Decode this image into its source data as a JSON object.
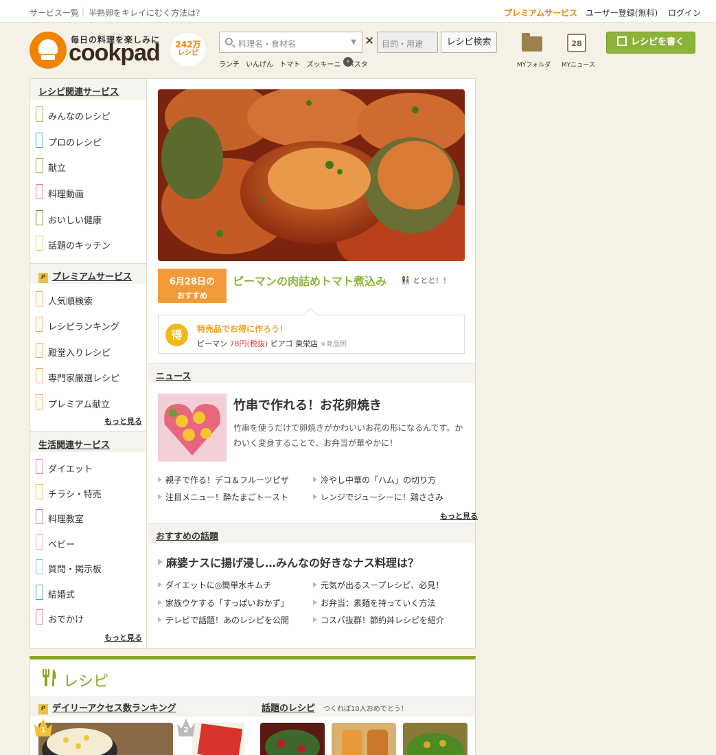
{
  "topbar": {
    "left_links": [
      "サービス一覧",
      "半熟卵をキレイにむく方法は？"
    ],
    "premium": "プレミアムサービス",
    "register": "ユーザー登録(無料)",
    "login": "ログイン"
  },
  "header": {
    "tagline": "毎日の料理を楽しみに",
    "wordmark": "cookpad",
    "recipe_count": "242万",
    "recipe_count_label": "レシピ",
    "search_placeholder": "料理名・食材名",
    "purpose_placeholder": "目的・用途",
    "search_button": "レシピ検索",
    "popular_keywords": [
      "ランチ",
      "いんげん",
      "トマト",
      "ズッキーニ",
      "パスタ"
    ],
    "my_folder": "MYフォルダ",
    "my_news": "MYニュース",
    "calendar_day": "28",
    "write_button": "レシピを書く"
  },
  "sidebar": {
    "recipe_services": {
      "title": "レシピ関連サービス",
      "items": [
        "みんなのレシピ",
        "プロのレシピ",
        "献立",
        "料理動画",
        "おいしい健康",
        "話題のキッチン"
      ]
    },
    "premium_services": {
      "badge": "P",
      "title": "プレミアムサービス",
      "items": [
        "人気順検索",
        "レシピランキング",
        "殿堂入りレシピ",
        "専門家厳選レシピ",
        "プレミアム献立"
      ],
      "more": "もっと見る"
    },
    "life_services": {
      "title": "生活関連サービス",
      "items": [
        "ダイエット",
        "チラシ・特売",
        "料理教室",
        "ベビー",
        "質問・掲示板",
        "結婚式",
        "おでかけ"
      ],
      "more": "もっと見る"
    }
  },
  "featured": {
    "date": "6月28日の",
    "date_sub": "おすすめ",
    "title": "ピーマンの肉詰めトマト煮込み",
    "author": "ととと！！",
    "deal_icon": "得",
    "deal_title": "特売品でお得に作ろう！",
    "deal_item": "ピーマン",
    "deal_price": "78円(税抜)",
    "deal_store": "ピアゴ 東栄店",
    "deal_note": "※商品例"
  },
  "news": {
    "section_title": "ニュース",
    "headline": "竹串で作れる！お花卵焼き",
    "description": "竹串を使うだけで卵焼きがかわいいお花の形になるんです。かわいく変身することで、お弁当が華やかに！",
    "links": [
      "親子で作る！デコ＆フルーツピザ",
      "冷やし中華の「ハム」の切り方",
      "注目メニュー！酔たまごトースト",
      "レンジでジューシーに！鶏ささみ"
    ],
    "more": "もっと見る"
  },
  "topics": {
    "section_title": "おすすめの話題",
    "headline": "麻婆ナスに揚げ浸し…みんなの好きなナス料理は？",
    "links": [
      "ダイエットに◎簡単水キムチ",
      "元気が出るスープレシピ、必見！",
      "家族ウケする「すっぱいおかず」",
      "お弁当：素麺を持っていく方法",
      "テレビで話題！あのレシピを公開",
      "コスパ抜群！節約丼レシピを紹介"
    ]
  },
  "recipes": {
    "title": "レシピ",
    "ranking_badge": "P",
    "ranking_title": "デイリーアクセス数ランキング",
    "rank1": "1",
    "rank2": "2",
    "trending_title": "話題のレシピ",
    "trending_sub": "つくれぽ10人おめでとう！"
  },
  "colors": {
    "accent_orange": "#f08300",
    "accent_green": "#8cb43a",
    "background": "#f6f1e6"
  }
}
